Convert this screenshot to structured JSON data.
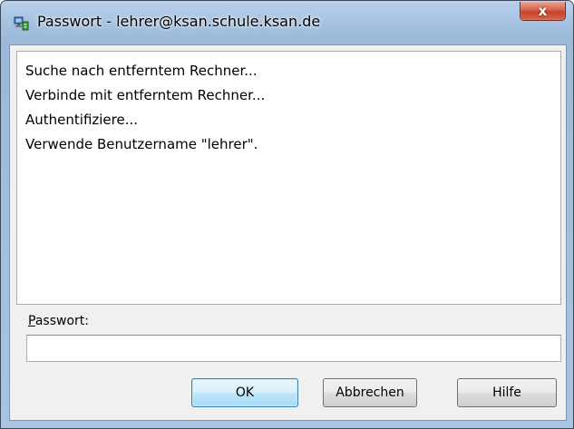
{
  "window": {
    "title": "Passwort - lehrer@ksan.schule.ksan.de",
    "app_icon": "network-computer-icon",
    "close_label": "x"
  },
  "log": {
    "lines": [
      "Suche nach entferntem Rechner...",
      "Verbinde mit entferntem Rechner...",
      "Authentifiziere...",
      "Verwende Benutzername \"lehrer\"."
    ]
  },
  "password": {
    "label_accel": "P",
    "label_rest": "asswort:",
    "value": ""
  },
  "buttons": {
    "ok": "OK",
    "cancel": "Abbrechen",
    "help": "Hilfe"
  },
  "colors": {
    "frame": "#a5c1e0",
    "close_button": "#c7412a",
    "default_button_border": "#3c7fb1"
  }
}
